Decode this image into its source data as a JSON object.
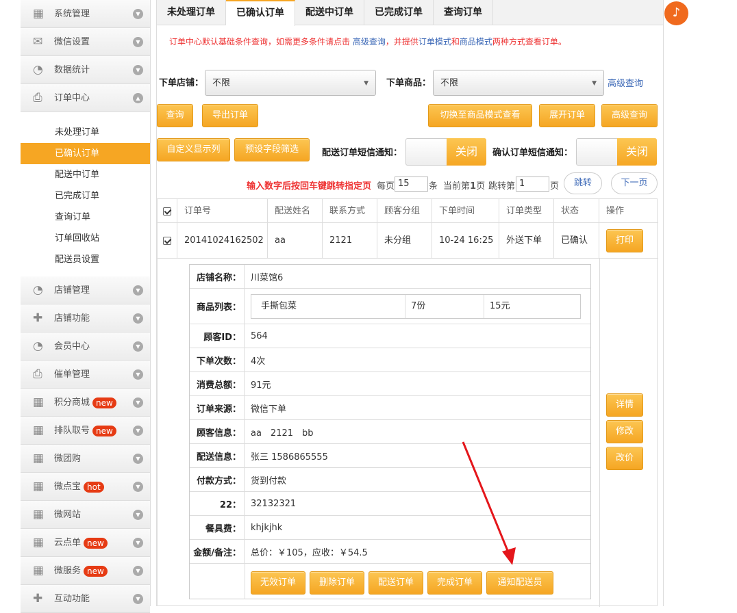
{
  "sidebar": {
    "menus_top": [
      {
        "label": "系统管理",
        "icon": "grid-icon"
      },
      {
        "label": "微信设置",
        "icon": "mail-icon"
      },
      {
        "label": "数据统计",
        "icon": "pie-icon"
      },
      {
        "label": "订单中心",
        "icon": "printer-icon"
      }
    ],
    "subs": [
      {
        "label": "未处理订单"
      },
      {
        "label": "已确认订单"
      },
      {
        "label": "配送中订单"
      },
      {
        "label": "已完成订单"
      },
      {
        "label": "查询订单"
      },
      {
        "label": "订单回收站"
      },
      {
        "label": "配送员设置"
      }
    ],
    "menus_bottom": [
      {
        "label": "店铺管理",
        "icon": "pie-icon",
        "badge": ""
      },
      {
        "label": "店铺功能",
        "icon": "plus-icon",
        "badge": ""
      },
      {
        "label": "会员中心",
        "icon": "pie-icon",
        "badge": ""
      },
      {
        "label": "催单管理",
        "icon": "printer-icon",
        "badge": ""
      },
      {
        "label": "积分商城",
        "icon": "grid-icon",
        "badge": "new"
      },
      {
        "label": "排队取号",
        "icon": "grid-icon",
        "badge": "new"
      },
      {
        "label": "微团购",
        "icon": "grid-icon",
        "badge": ""
      },
      {
        "label": "微点宝",
        "icon": "grid-icon",
        "badge": "hot"
      },
      {
        "label": "微网站",
        "icon": "grid-icon",
        "badge": ""
      },
      {
        "label": "云点单",
        "icon": "grid-icon",
        "badge": "new"
      },
      {
        "label": "微服务",
        "icon": "grid-icon",
        "badge": "new"
      },
      {
        "label": "互动功能",
        "icon": "plus-icon",
        "badge": ""
      }
    ]
  },
  "tabs": [
    "未处理订单",
    "已确认订单",
    "配送中订单",
    "已完成订单",
    "查询订单"
  ],
  "notice": {
    "a": "订单中心默认基础条件查询，如需更多条件请点击",
    "link": "高级查询",
    "b": "，并提供",
    "m1": "订单模式",
    "and": "和",
    "m2": "商品模式",
    "c": "两种方式查看订单。"
  },
  "filter": {
    "store_label": "下单店铺：",
    "store_value": "不限",
    "goods_label": "下单商品：",
    "goods_value": "不限",
    "advanced": "高级查询"
  },
  "buttons": {
    "query": "查询",
    "export": "导出订单",
    "switch_mode": "切换至商品模式查看",
    "expand": "展开订单",
    "advanced": "高级查询",
    "custom_cols": "自定义显示列",
    "preset_filter": "预设字段筛选"
  },
  "sms": {
    "delivery_label": "配送订单短信通知：",
    "delivery_state": "关闭",
    "confirm_label": "确认订单短信通知：",
    "confirm_state": "关闭"
  },
  "pager": {
    "hint": "输入数字后按回车键跳转指定页",
    "per_page": "每页",
    "per_value": "15",
    "unit": "条",
    "current_pre": "当前第",
    "current": "1",
    "current_post": "页",
    "jump_pre": "跳转第",
    "jump_value": "1",
    "jump_post": "页",
    "jump_btn": "跳转",
    "next_btn": "下一页"
  },
  "table": {
    "headers": [
      "订单号",
      "配送姓名",
      "联系方式",
      "顾客分组",
      "下单时间",
      "订单类型",
      "状态",
      "操作"
    ],
    "row": {
      "order_no": "20141024162502",
      "name": "aa",
      "contact": "2121",
      "group": "未分组",
      "time": "10-24 16:25",
      "type": "外送下单",
      "status": "已确认"
    },
    "print": "打印",
    "side_actions": [
      "详情",
      "修改",
      "改价"
    ]
  },
  "detail": {
    "store_label": "店铺名称：",
    "store": "川菜馆6",
    "goods_label": "商品列表：",
    "goods": {
      "name": "手撕包菜",
      "qty": "7份",
      "price": "15元"
    },
    "rows": [
      {
        "label": "顾客ID：",
        "value": "564"
      },
      {
        "label": "下单次数：",
        "value": "4次"
      },
      {
        "label": "消费总额：",
        "value": "91元"
      },
      {
        "label": "订单来源：",
        "value": "微信下单"
      },
      {
        "label": "顾客信息：",
        "value": "aa　2121　bb"
      },
      {
        "label": "配送信息：",
        "value": "张三  1586865555"
      },
      {
        "label": "付款方式：",
        "value": "货到付款"
      },
      {
        "label": "22：",
        "value": "32132321"
      },
      {
        "label": "餐具费：",
        "value": "khjkjhk"
      },
      {
        "label": "金额/备注：",
        "value": "总价：￥105，应收：￥54.5"
      }
    ],
    "actions": [
      "无效订单",
      "删除订单",
      "配送订单",
      "完成订单",
      "通知配送员"
    ]
  },
  "colors": {
    "accent": "#f6a623",
    "alert": "#e33333",
    "link": "#3a67b6"
  }
}
